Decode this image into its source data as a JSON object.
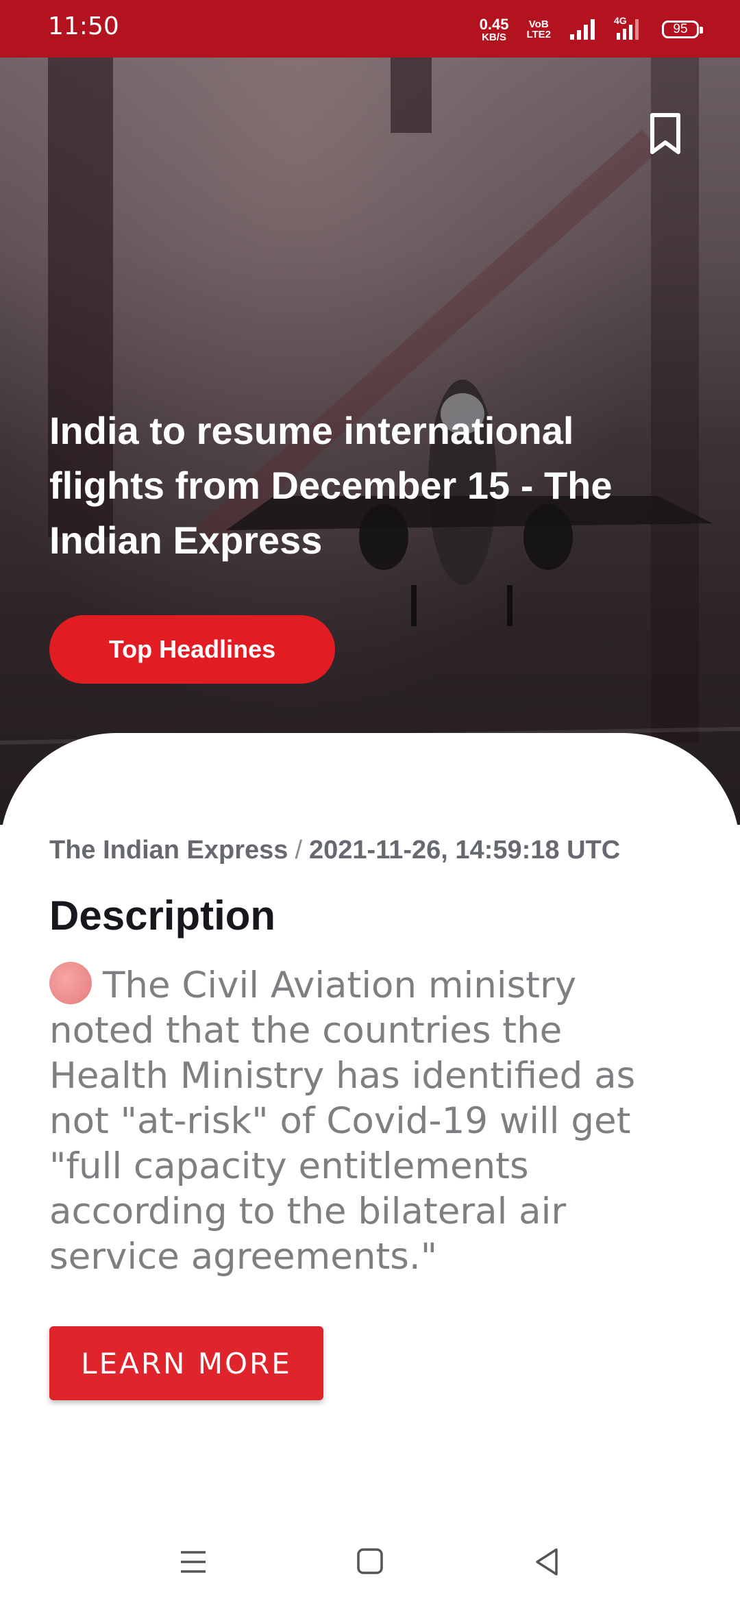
{
  "status_bar": {
    "time": "11:50",
    "net_speed_value": "0.45",
    "net_speed_unit": "KB/S",
    "volte_top": "VoB",
    "volte_bottom": "LTE2",
    "network_type": "4G",
    "battery_level": "95"
  },
  "article": {
    "title": "India to resume international flights from December 15 - The Indian Express",
    "category_button": "Top Headlines",
    "source": "The Indian Express",
    "separator": "/",
    "published": "2021-11-26, 14:59:18 UTC",
    "description_heading": "Description",
    "description": "The Civil Aviation ministry noted that the countries the Health Ministry has identified as not \"at-risk\" of Covid-19 will get \"full capacity entitlements according to the bilateral air service agreements.\"",
    "learn_more_label": "LEARN MORE"
  },
  "icons": {
    "bookmark": "bookmark-icon",
    "menu": "menu-icon",
    "home": "home-icon",
    "back": "back-icon"
  },
  "colors": {
    "status_bar": "#b3121f",
    "accent": "#e21c23"
  }
}
